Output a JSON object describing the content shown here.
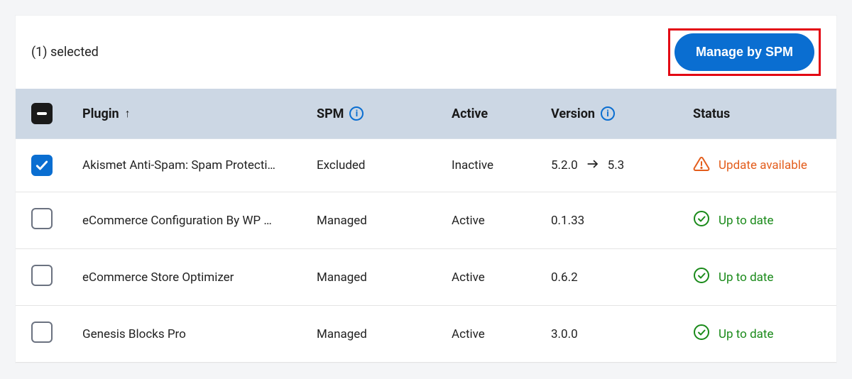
{
  "topbar": {
    "selected_text": "(1) selected",
    "manage_button_label": "Manage by SPM"
  },
  "columns": {
    "plugin": "Plugin",
    "spm": "SPM",
    "active": "Active",
    "version": "Version",
    "status": "Status"
  },
  "rows": [
    {
      "checked": true,
      "plugin": "Akismet Anti-Spam: Spam Protecti…",
      "spm": "Excluded",
      "active": "Inactive",
      "version_from": "5.2.0",
      "version_to": "5.3",
      "status_text": "Update available",
      "status_type": "update"
    },
    {
      "checked": false,
      "plugin": "eCommerce Configuration By WP …",
      "spm": "Managed",
      "active": "Active",
      "version_from": "0.1.33",
      "version_to": "",
      "status_text": "Up to date",
      "status_type": "ok"
    },
    {
      "checked": false,
      "plugin": "eCommerce Store Optimizer",
      "spm": "Managed",
      "active": "Active",
      "version_from": "0.6.2",
      "version_to": "",
      "status_text": "Up to date",
      "status_type": "ok"
    },
    {
      "checked": false,
      "plugin": "Genesis Blocks Pro",
      "spm": "Managed",
      "active": "Active",
      "version_from": "3.0.0",
      "version_to": "",
      "status_text": "Up to date",
      "status_type": "ok"
    }
  ]
}
